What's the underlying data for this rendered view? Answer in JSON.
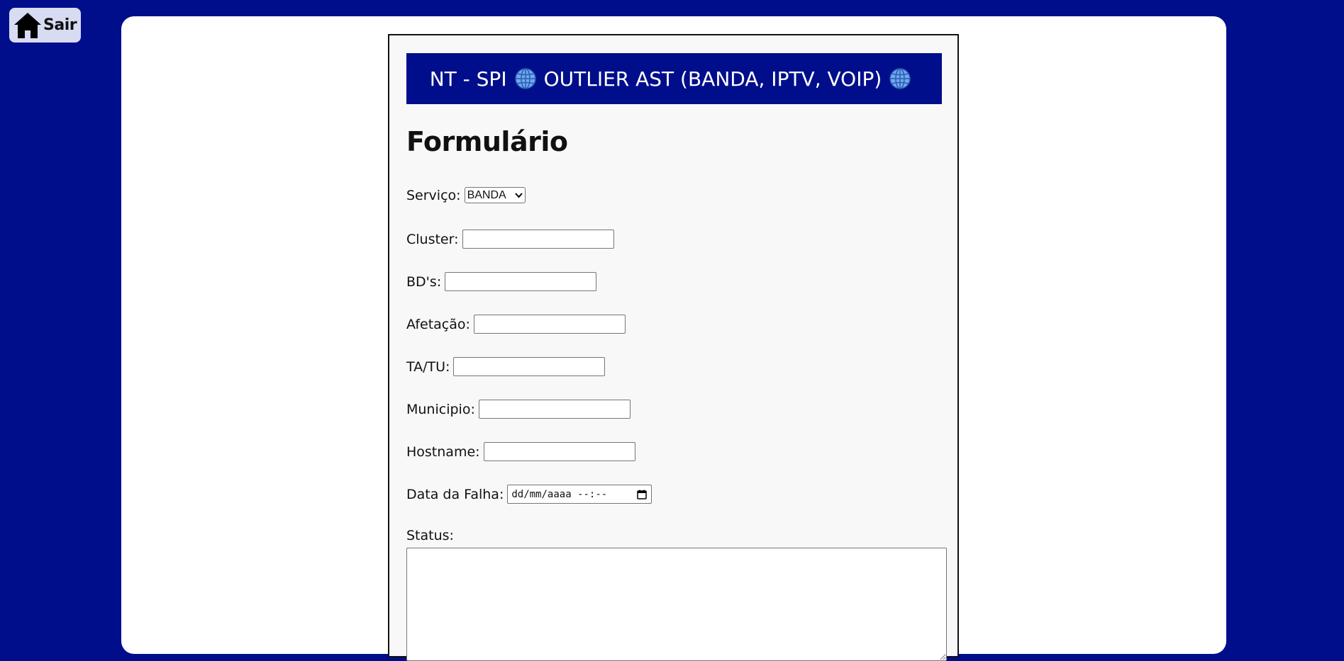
{
  "nav": {
    "exit_label": "Sair",
    "exit_icon": "home-icon"
  },
  "colors": {
    "brand_blue": "#000e8c",
    "panel_bg": "#ffffff",
    "form_bg": "#f8f8f8",
    "exit_button_bg": "#d8dcf2"
  },
  "banner": {
    "left_text": "NT - SPI",
    "right_text": "OUTLIER AST (BANDA, IPTV, VOIP)",
    "icon": "globe-icon"
  },
  "form": {
    "title": "Formulário",
    "servico": {
      "label": "Serviço:",
      "selected": "BANDA"
    },
    "cluster": {
      "label": "Cluster:",
      "value": ""
    },
    "bds": {
      "label": "BD's:",
      "value": ""
    },
    "afetacao": {
      "label": "Afetação:",
      "value": ""
    },
    "tatu": {
      "label": "TA/TU:",
      "value": ""
    },
    "municipio": {
      "label": "Municipio:",
      "value": ""
    },
    "hostname": {
      "label": "Hostname:",
      "value": ""
    },
    "data_falha": {
      "label": "Data da Falha:",
      "placeholder": "dd/mm/aaaa --:--"
    },
    "status": {
      "label": "Status:",
      "value": ""
    }
  }
}
